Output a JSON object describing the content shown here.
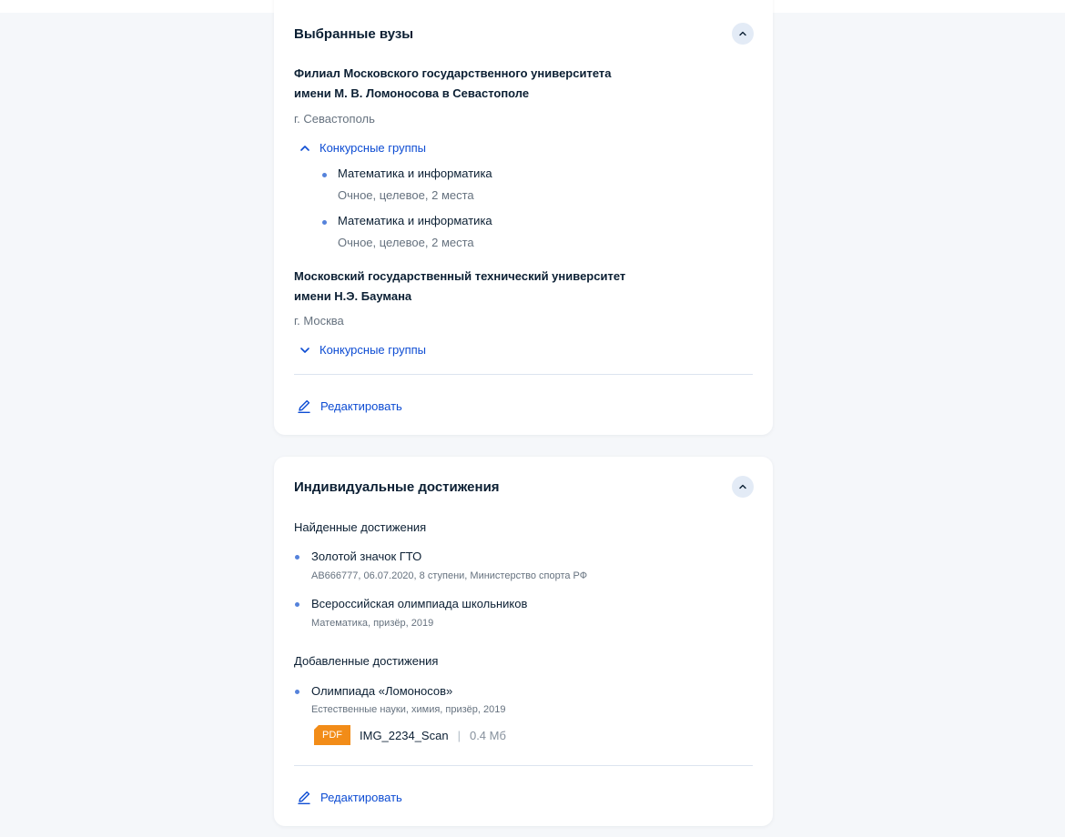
{
  "universities_card": {
    "title": "Выбранные вузы",
    "universities": [
      {
        "name_line1": "Филиал Московского государственного университета",
        "name_line2": "имени М. В. Ломоносова в Севастополе",
        "city": "г. Севастополь",
        "groups_label": "Конкурсные группы",
        "groups_expanded": true,
        "groups": [
          {
            "title": "Математика и информатика",
            "details": "Очное, целевое, 2 места"
          },
          {
            "title": "Математика и информатика",
            "details": "Очное, целевое, 2 места"
          }
        ]
      },
      {
        "name_line1": "Московский государственный технический университет",
        "name_line2": "имени Н.Э. Баумана",
        "city": "г. Москва",
        "groups_label": "Конкурсные группы",
        "groups_expanded": false
      }
    ],
    "edit_label": "Редактировать"
  },
  "achievements_card": {
    "title": "Индивидуальные достижения",
    "found_label": "Найденные достижения",
    "found": [
      {
        "title": "Золотой значок ГТО",
        "details": "АВ666777, 06.07.2020, 8 ступени, Министерство спорта РФ"
      },
      {
        "title": "Всероссийская олимпиада школьников",
        "details": "Математика, призёр, 2019"
      }
    ],
    "added_label": "Добавленные достижения",
    "added": [
      {
        "title": "Олимпиада «Ломоносов»",
        "details": "Естественные науки, химия, призёр, 2019",
        "file": {
          "type": "PDF",
          "name": "IMG_2234_Scan",
          "separator": "|",
          "size": "0.4 Мб"
        }
      }
    ],
    "edit_label": "Редактировать"
  },
  "colors": {
    "accent": "#0d4cd3",
    "bullet": "#5582db",
    "pdf_badge": "#f28c18",
    "background": "#f5f7fa"
  }
}
